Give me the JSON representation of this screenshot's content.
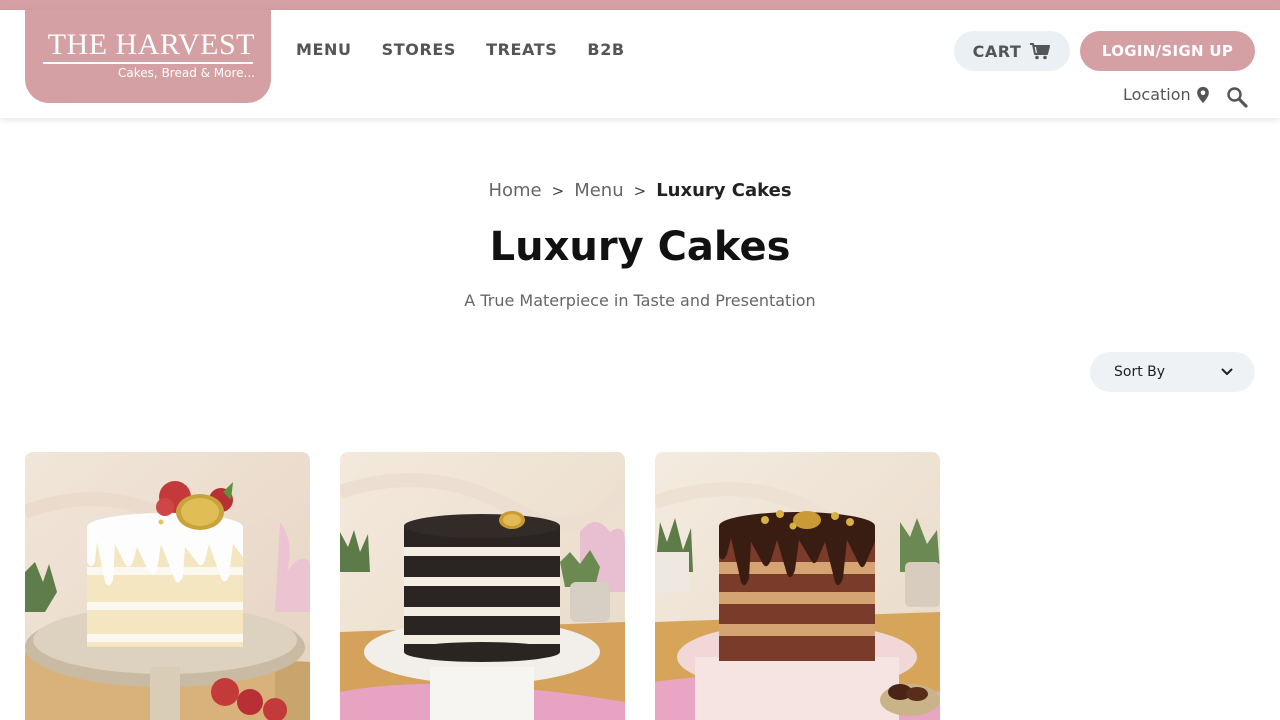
{
  "brand": {
    "name": "THE HARVEST",
    "tagline": "Cakes, Bread & More...",
    "color": "#d4a0a3"
  },
  "nav": {
    "items": [
      {
        "label": "MENU"
      },
      {
        "label": "STORES"
      },
      {
        "label": "TREATS"
      },
      {
        "label": "B2B"
      }
    ]
  },
  "header": {
    "cart_label": "CART",
    "cart_icon": "shopping-cart-icon",
    "login_label": "LOGIN/SIGN UP",
    "location_label": "Location",
    "location_icon": "map-pin-icon",
    "search_icon": "search-icon"
  },
  "breadcrumb": {
    "home": "Home",
    "menu": "Menu",
    "current": "Luxury Cakes",
    "separator": ">"
  },
  "page": {
    "title": "Luxury Cakes",
    "subtitle": "A True Materpiece in Taste and Presentation"
  },
  "sort": {
    "label": "Sort By",
    "icon": "chevron-down-icon"
  },
  "products": [
    {
      "image": "white-drip-naked-cake-image"
    },
    {
      "image": "black-and-white-layer-cake-image"
    },
    {
      "image": "chocolate-drip-layer-cake-image"
    }
  ]
}
